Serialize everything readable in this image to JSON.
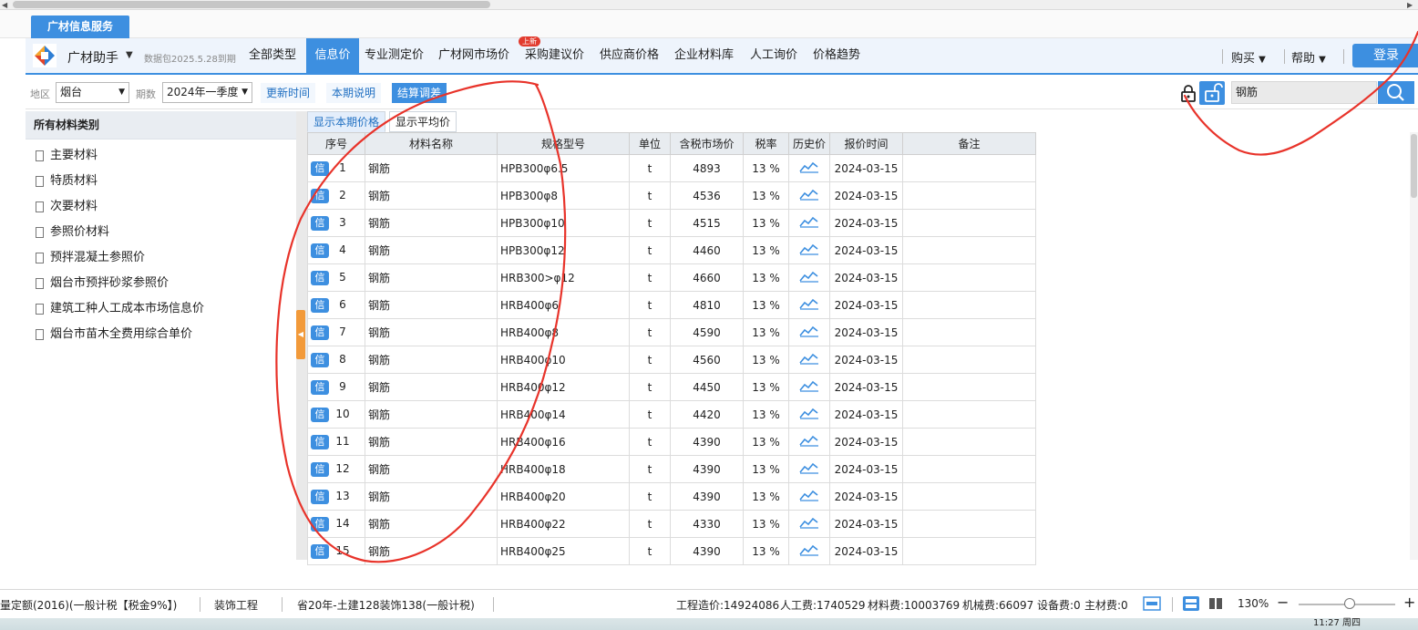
{
  "app_tab": "广材信息服务",
  "brand": {
    "name": "广材助手",
    "data_package": "数据包2025.5.28到期"
  },
  "nav": {
    "items": [
      "全部类型",
      "信息价",
      "专业测定价",
      "广材网市场价",
      "采购建议价",
      "供应商价格",
      "企业材料库",
      "人工询价",
      "价格趋势"
    ],
    "active": "信息价",
    "new_badge": "上新",
    "right": {
      "buy": "购买",
      "help": "帮助",
      "login": "登录"
    }
  },
  "filters": {
    "region_label": "地区",
    "region_value": "烟台",
    "period_label": "期数",
    "period_value": "2024年一季度",
    "buttons": [
      "更新时间",
      "本期说明",
      "结算调差"
    ],
    "active_button": "结算调差",
    "search_value": "钢筋"
  },
  "sidebar": {
    "title": "所有材料类别",
    "items": [
      "主要材料",
      "特质材料",
      "次要材料",
      "参照价材料",
      "预拌混凝土参照价",
      "烟台市预拌砂浆参照价",
      "建筑工种人工成本市场信息价",
      "烟台市苗木全费用综合单价"
    ]
  },
  "subtabs": {
    "current": "显示本期价格",
    "average": "显示平均价"
  },
  "table": {
    "headers": [
      "序号",
      "材料名称",
      "规格型号",
      "单位",
      "含税市场价",
      "税率",
      "历史价",
      "报价时间",
      "备注"
    ],
    "badge": "信",
    "rows": [
      {
        "no": "1",
        "name": "钢筋",
        "spec": "HPB300φ6.5",
        "unit": "t",
        "price": "4893",
        "tax": "13 %",
        "date": "2024-03-15",
        "note": ""
      },
      {
        "no": "2",
        "name": "钢筋",
        "spec": "HPB300φ8",
        "unit": "t",
        "price": "4536",
        "tax": "13 %",
        "date": "2024-03-15",
        "note": ""
      },
      {
        "no": "3",
        "name": "钢筋",
        "spec": "HPB300φ10",
        "unit": "t",
        "price": "4515",
        "tax": "13 %",
        "date": "2024-03-15",
        "note": ""
      },
      {
        "no": "4",
        "name": "钢筋",
        "spec": "HPB300φ12",
        "unit": "t",
        "price": "4460",
        "tax": "13 %",
        "date": "2024-03-15",
        "note": ""
      },
      {
        "no": "5",
        "name": "钢筋",
        "spec": "HRB300>φ12",
        "unit": "t",
        "price": "4660",
        "tax": "13 %",
        "date": "2024-03-15",
        "note": ""
      },
      {
        "no": "6",
        "name": "钢筋",
        "spec": "HRB400φ6",
        "unit": "t",
        "price": "4810",
        "tax": "13 %",
        "date": "2024-03-15",
        "note": ""
      },
      {
        "no": "7",
        "name": "钢筋",
        "spec": "HRB400φ8",
        "unit": "t",
        "price": "4590",
        "tax": "13 %",
        "date": "2024-03-15",
        "note": ""
      },
      {
        "no": "8",
        "name": "钢筋",
        "spec": "HRB400φ10",
        "unit": "t",
        "price": "4560",
        "tax": "13 %",
        "date": "2024-03-15",
        "note": ""
      },
      {
        "no": "9",
        "name": "钢筋",
        "spec": "HRB400φ12",
        "unit": "t",
        "price": "4450",
        "tax": "13 %",
        "date": "2024-03-15",
        "note": ""
      },
      {
        "no": "10",
        "name": "钢筋",
        "spec": "HRB400φ14",
        "unit": "t",
        "price": "4420",
        "tax": "13 %",
        "date": "2024-03-15",
        "note": ""
      },
      {
        "no": "11",
        "name": "钢筋",
        "spec": "HRB400φ16",
        "unit": "t",
        "price": "4390",
        "tax": "13 %",
        "date": "2024-03-15",
        "note": ""
      },
      {
        "no": "12",
        "name": "钢筋",
        "spec": "HRB400φ18",
        "unit": "t",
        "price": "4390",
        "tax": "13 %",
        "date": "2024-03-15",
        "note": ""
      },
      {
        "no": "13",
        "name": "钢筋",
        "spec": "HRB400φ20",
        "unit": "t",
        "price": "4390",
        "tax": "13 %",
        "date": "2024-03-15",
        "note": ""
      },
      {
        "no": "14",
        "name": "钢筋",
        "spec": "HRB400φ22",
        "unit": "t",
        "price": "4330",
        "tax": "13 %",
        "date": "2024-03-15",
        "note": ""
      },
      {
        "no": "15",
        "name": "钢筋",
        "spec": "HRB400φ25",
        "unit": "t",
        "price": "4390",
        "tax": "13 %",
        "date": "2024-03-15",
        "note": ""
      }
    ]
  },
  "status": {
    "quota": "量定额(2016)(一般计税【税金9%】)",
    "project_type": "装饰工程",
    "fee_standard": "省20年-土建128装饰138(一般计税)",
    "total_cost": "工程造价:14924086",
    "labor": "人工费:1740529",
    "material": "材料费:10003769",
    "machine": "机械费:66097",
    "equipment": "设备费:0",
    "main_material": "主材费:0",
    "zoom": "130%"
  },
  "taskbar": {
    "clock": "11:27 周四"
  },
  "colors": {
    "accent": "#3d8fe0",
    "annotation": "#e8332a",
    "handle": "#f29a3a"
  },
  "icons": {
    "lock_closed": "lock-icon",
    "lock_open": "unlock-icon",
    "search": "search-icon",
    "history": "trend-chart-icon",
    "doc": "document-icon"
  }
}
